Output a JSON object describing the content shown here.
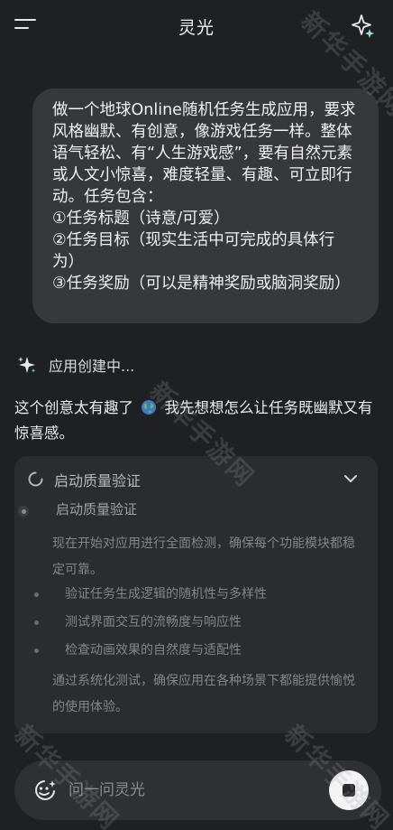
{
  "header": {
    "title": "灵光"
  },
  "user_message": {
    "text": "做一个地球Online随机任务生成应用，要求风格幽默、有创意，像游戏任务一样。整体语气轻松、有“人生游戏感”，要有自然元素或人文小惊喜，难度轻量、有趣、可立即行动。任务包含：\n①任务标题（诗意/可爱）\n②任务目标（现实生活中可完成的具体行为）\n③任务奖励（可以是精神奖励或脑洞奖励）"
  },
  "status": {
    "text": "应用创建中..."
  },
  "reply": {
    "before": "这个创意太有趣了",
    "after": "我先想想怎么让任务既幽默又有惊喜感。"
  },
  "progress_card": {
    "header_label": "启动质量验证",
    "step_title": "启动质量验证",
    "intro": "现在开始对应用进行全面检测，确保每个功能模块都稳定可靠。",
    "bullets": [
      "验证任务生成逻辑的随机性与多样性",
      "测试界面交互的流畅度与响应性",
      "检查动画效果的自然度与适配性"
    ],
    "summary": "通过系统化测试，确保应用在各种场景下都能提供愉悦的使用体验。"
  },
  "composer": {
    "placeholder": "问一问灵光"
  },
  "watermark": {
    "text": "新华手游网"
  },
  "icons": {
    "menu": "menu-icon",
    "new_chat": "sparkle-plus-icon",
    "status": "sparkles-icon",
    "globe": "globe-icon",
    "spinner": "spinner-icon",
    "expand": "chevron-down-icon",
    "camera": "camera-sparkle-icon",
    "stop": "stop-icon"
  },
  "colors": {
    "background": "#1f2022",
    "bubble": "#37383c",
    "card": "#2b2c2f",
    "input_bar": "#2f3033",
    "stop_button": "#f4f4f5"
  }
}
